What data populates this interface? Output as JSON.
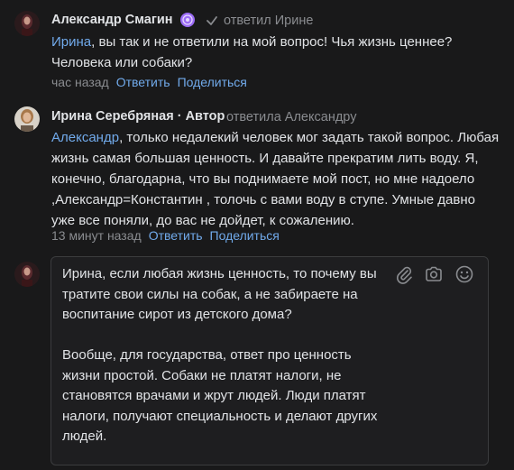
{
  "comments": [
    {
      "author": "Александр Смагин",
      "replied": "ответил Ирине",
      "mention": "Ирина",
      "text": ", вы так и не ответили на мой вопрос! Чья жизнь ценнее? Человека или собаки?",
      "time": "час назад",
      "reply_label": "Ответить",
      "share_label": "Поделиться"
    },
    {
      "author": "Ирина Серебряная",
      "author_badge": " · Автор",
      "replied": "ответила Александру",
      "mention": "Александр",
      "text": ", только недалекий человек мог задать такой вопрос. Любая жизнь самая большая ценность. И давайте прекратим лить воду. Я, конечно, благодарна, что вы поднимаете мой пост, но мне надоело ,Александр=Константин , толочь с вами воду в ступе. Умные давно уже все поняли, до вас не дойдет, к сожалению.",
      "time": "13 минут назад",
      "reply_label": "Ответить",
      "share_label": "Поделиться"
    }
  ],
  "composer": {
    "text": "Ирина, если любая жизнь ценность, то почему вы тратите свои силы на собак, а не забираете на воспитание сирот из детского дома?\n\nВообще, для государства, ответ про ценность жизни простой. Собаки не платят налоги, не становятся врачами и жрут людей. Люди платят налоги, получают специальность и делают других людей.\n\nВы не за собак. Вы против людей.",
    "icons": [
      "paperclip-icon",
      "camera-icon",
      "emoji-icon"
    ]
  },
  "colors": {
    "background": "#19191a",
    "link": "#71aaeb",
    "muted": "#8a8c90",
    "text": "#e1e3e6",
    "badge": "#9b6cf5"
  }
}
